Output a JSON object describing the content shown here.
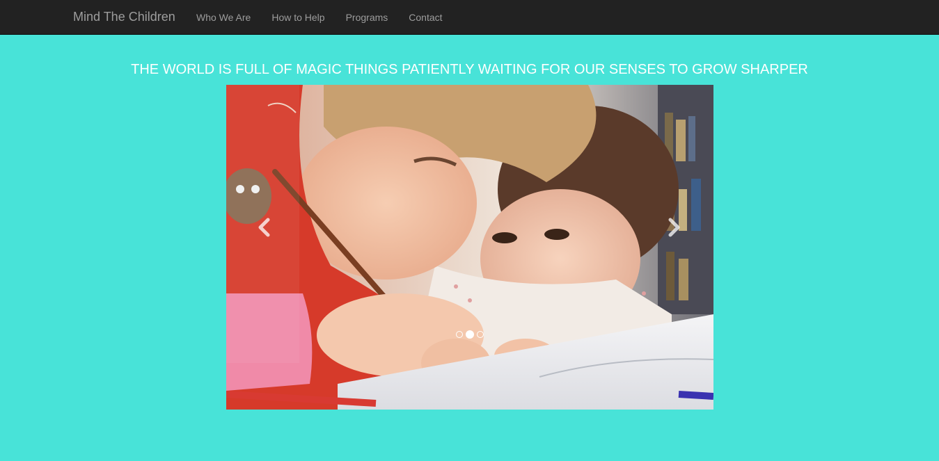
{
  "navbar": {
    "brand": "Mind The Children",
    "links": [
      {
        "label": "Who We Are"
      },
      {
        "label": "How to Help"
      },
      {
        "label": "Programs"
      },
      {
        "label": "Contact"
      }
    ]
  },
  "hero": {
    "headline": "THE WORLD IS FULL OF MAGIC THINGS PATIENTLY WAITING FOR OUR SENSES TO GROW SHARPER"
  },
  "carousel": {
    "slide_count": 3,
    "active_index": 1,
    "prev_icon": "chevron-left-icon",
    "next_icon": "chevron-right-icon"
  },
  "colors": {
    "navbar_bg": "#222222",
    "nav_text": "#9d9d9d",
    "page_bg": "#48e3d8",
    "headline_text": "#ffffff"
  }
}
